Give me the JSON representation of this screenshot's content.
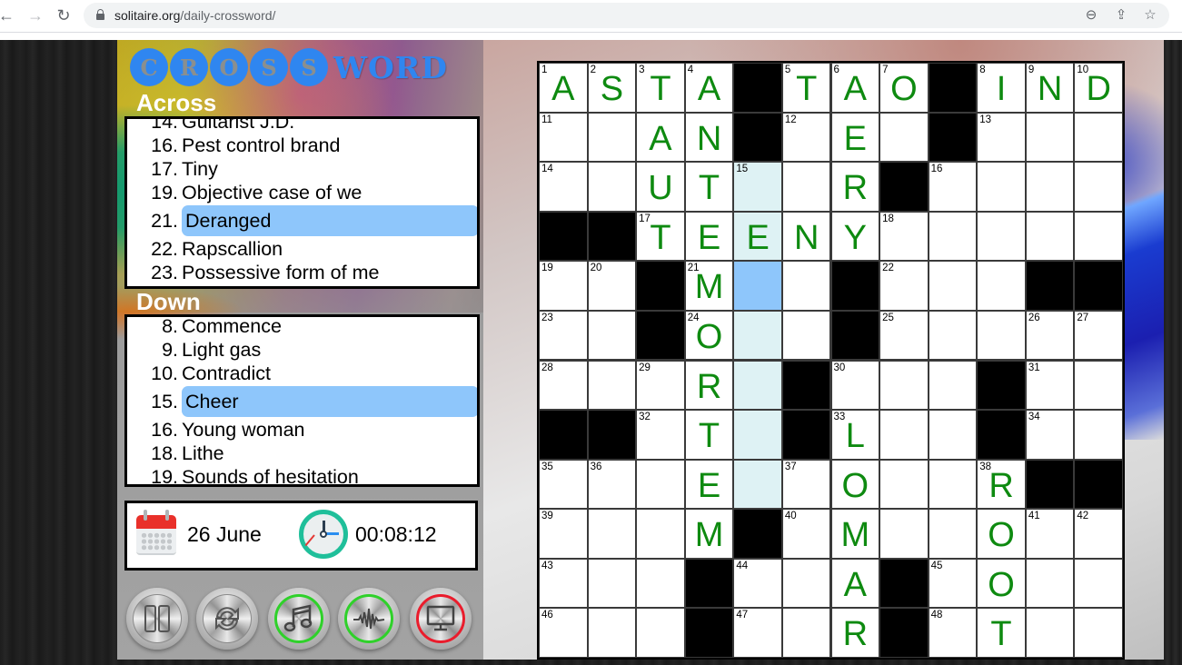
{
  "browser": {
    "url_domain": "solitaire.org",
    "url_path": "/daily-crossword/",
    "back_icon": "←",
    "forward_icon": "→",
    "reload_icon": "↻",
    "zoom_icon": "⊖",
    "share_icon": "⇪",
    "bookmark_icon": "☆"
  },
  "game": {
    "logo_balls": [
      "C",
      "R",
      "O",
      "S",
      "S"
    ],
    "logo_word": "WORD",
    "across_title": "Across",
    "down_title": "Down",
    "across_clues": [
      {
        "num": "14.",
        "text": "Guitarist J.D.",
        "active": false
      },
      {
        "num": "16.",
        "text": "Pest control brand",
        "active": false
      },
      {
        "num": "17.",
        "text": "Tiny",
        "active": false
      },
      {
        "num": "19.",
        "text": "Objective case of we",
        "active": false
      },
      {
        "num": "21.",
        "text": "Deranged",
        "active": true
      },
      {
        "num": "22.",
        "text": "Rapscallion",
        "active": false
      },
      {
        "num": "23.",
        "text": "Possessive form of me",
        "active": false
      }
    ],
    "down_clues": [
      {
        "num": "8.",
        "text": "Commence",
        "active": false
      },
      {
        "num": "9.",
        "text": "Light gas",
        "active": false
      },
      {
        "num": "10.",
        "text": "Contradict",
        "active": false
      },
      {
        "num": "15.",
        "text": "Cheer",
        "active": true
      },
      {
        "num": "16.",
        "text": "Young woman",
        "active": false
      },
      {
        "num": "18.",
        "text": "Lithe",
        "active": false
      },
      {
        "num": "19.",
        "text": "Sounds of hesitation",
        "active": false
      }
    ],
    "date": "26 June",
    "timer": "00:08:12",
    "controls": [
      {
        "name": "pause-button",
        "icon": "pause-icon",
        "state": "neutral"
      },
      {
        "name": "restart-button",
        "icon": "restart-icon",
        "state": "neutral"
      },
      {
        "name": "music-button",
        "icon": "music-note-icon",
        "state": "on"
      },
      {
        "name": "sound-button",
        "icon": "sound-wave-icon",
        "state": "on"
      },
      {
        "name": "fullscreen-button",
        "icon": "monitor-icon",
        "state": "off"
      }
    ],
    "colors": {
      "letter": "#0e8a10",
      "selected_cell": "#8ec6fb",
      "related_cell": "#def2f4",
      "toggle_on": "#2fd12a",
      "toggle_off": "#ea1c2c"
    },
    "grid": {
      "rows": 12,
      "cols": 12,
      "cells": [
        [
          {
            "n": "1",
            "l": "A"
          },
          {
            "n": "2",
            "l": "S"
          },
          {
            "n": "3",
            "l": "T"
          },
          {
            "n": "4",
            "l": "A"
          },
          {
            "b": 1
          },
          {
            "n": "5",
            "l": "T"
          },
          {
            "n": "6",
            "l": "A"
          },
          {
            "n": "7",
            "l": "O"
          },
          {
            "b": 1
          },
          {
            "n": "8",
            "l": "I"
          },
          {
            "n": "9",
            "l": "N"
          },
          {
            "n": "10",
            "l": "D"
          }
        ],
        [
          {
            "n": "11"
          },
          {},
          {
            "l": "A"
          },
          {
            "l": "N"
          },
          {
            "b": 1
          },
          {
            "n": "12"
          },
          {
            "l": "E"
          },
          {},
          {
            "b": 1
          },
          {
            "n": "13"
          },
          {},
          {}
        ],
        [
          {
            "n": "14"
          },
          {},
          {
            "l": "U"
          },
          {
            "l": "T"
          },
          {
            "n": "15",
            "s": "related"
          },
          {},
          {
            "l": "R"
          },
          {
            "b": 1
          },
          {
            "n": "16"
          },
          {},
          {},
          {}
        ],
        [
          {
            "b": 1
          },
          {
            "b": 1
          },
          {
            "n": "17",
            "l": "T"
          },
          {
            "l": "E"
          },
          {
            "l": "E",
            "s": "related"
          },
          {
            "l": "N"
          },
          {
            "l": "Y"
          },
          {
            "n": "18"
          },
          {},
          {},
          {},
          {}
        ],
        [
          {
            "n": "19"
          },
          {
            "n": "20"
          },
          {
            "b": 1
          },
          {
            "n": "21",
            "l": "M"
          },
          {
            "s": "selected"
          },
          {},
          {
            "b": 1
          },
          {
            "n": "22"
          },
          {},
          {},
          {
            "b": 1
          },
          {
            "b": 1
          }
        ],
        [
          {
            "n": "23"
          },
          {},
          {
            "b": 1
          },
          {
            "n": "24",
            "l": "O"
          },
          {
            "s": "related"
          },
          {},
          {
            "b": 1
          },
          {
            "n": "25"
          },
          {},
          {},
          {
            "n": "26"
          },
          {
            "n": "27"
          }
        ],
        [
          {
            "n": "28"
          },
          {},
          {
            "n": "29"
          },
          {
            "l": "R"
          },
          {
            "s": "related"
          },
          {
            "b": 1
          },
          {
            "n": "30"
          },
          {},
          {},
          {
            "b": 1
          },
          {
            "n": "31"
          },
          {}
        ],
        [
          {
            "b": 1
          },
          {
            "b": 1
          },
          {
            "n": "32"
          },
          {
            "l": "T"
          },
          {
            "s": "related"
          },
          {
            "b": 1
          },
          {
            "n": "33",
            "l": "L"
          },
          {},
          {},
          {
            "b": 1
          },
          {
            "n": "34"
          },
          {}
        ],
        [
          {
            "n": "35"
          },
          {
            "n": "36"
          },
          {},
          {
            "l": "E"
          },
          {
            "s": "related"
          },
          {
            "n": "37"
          },
          {
            "l": "O"
          },
          {},
          {},
          {
            "n": "38",
            "l": "R"
          },
          {
            "b": 1
          },
          {
            "b": 1
          }
        ],
        [
          {
            "n": "39"
          },
          {},
          {},
          {
            "l": "M"
          },
          {
            "b": 1
          },
          {
            "n": "40"
          },
          {
            "l": "M"
          },
          {},
          {},
          {
            "l": "O"
          },
          {
            "n": "41"
          },
          {
            "n": "42"
          }
        ],
        [
          {
            "n": "43"
          },
          {},
          {},
          {
            "b": 1
          },
          {
            "n": "44"
          },
          {},
          {
            "l": "A"
          },
          {
            "b": 1
          },
          {
            "n": "45"
          },
          {
            "l": "O"
          },
          {},
          {}
        ],
        [
          {
            "n": "46"
          },
          {},
          {},
          {
            "b": 1
          },
          {
            "n": "47"
          },
          {},
          {
            "l": "R"
          },
          {
            "b": 1
          },
          {
            "n": "48"
          },
          {
            "l": "T"
          },
          {},
          {}
        ]
      ]
    }
  }
}
